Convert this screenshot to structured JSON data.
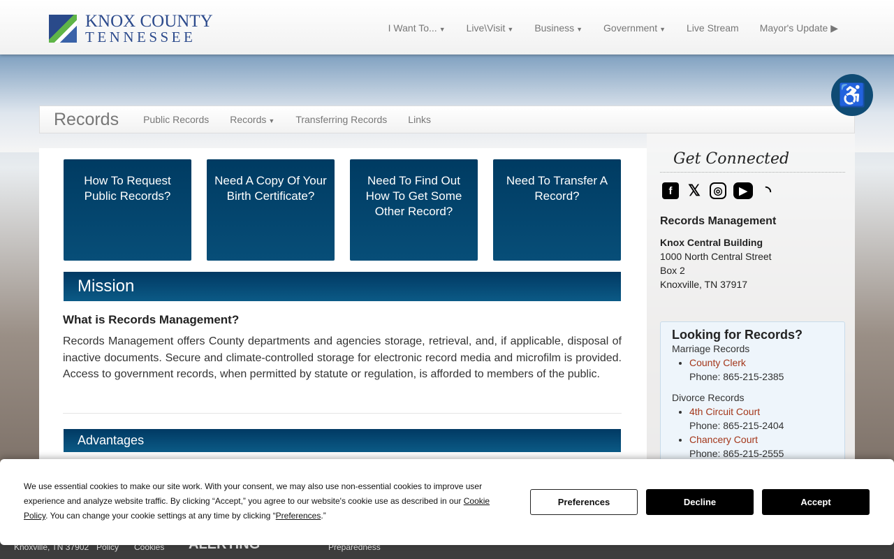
{
  "header": {
    "logo_line1": "KNOX COUNTY",
    "logo_line2": "TENNESSEE",
    "nav": [
      "I Want To...",
      "Live\\Visit",
      "Business",
      "Government",
      "Live Stream",
      "Mayor's Update"
    ]
  },
  "subnav": {
    "brand": "Records",
    "items": [
      "Public Records",
      "Records",
      "Transferring Records",
      "Links"
    ]
  },
  "tiles": [
    "How To Request Public Records?",
    "Need A Copy Of Your Birth Certificate?",
    "Need To Find Out How To Get Some Other Record?",
    "Need To Transfer A Record?"
  ],
  "main": {
    "mission": "Mission",
    "question": "What is Records Management?",
    "paragraph": "Records Management offers County departments and agencies storage, retrieval, and, if applicable, disposal of inactive documents. Secure and climate-controlled storage for electronic record media and microfilm is provided. Access to government records, when permitted by statute or regulation, is afforded to members of the public.",
    "advantages": "Advantages"
  },
  "sidebar": {
    "get_connected": "Get Connected",
    "social": [
      "facebook",
      "x",
      "instagram",
      "youtube",
      "rss"
    ],
    "office": "Records Management",
    "building": "Knox Central Building",
    "street": "1000 North Central Street",
    "box": "Box 2",
    "city": "Knoxville, TN 37917",
    "looking": {
      "title": "Looking for Records?",
      "marriage": "Marriage Records",
      "clerk": "County Clerk",
      "clerk_phone": "Phone: 865-215-2385",
      "divorce": "Divorce Records",
      "circuit": "4th Circuit Court",
      "circuit_phone": "Phone: 865-215-2404",
      "chancery": "Chancery Court",
      "chancery_phone": "Phone: 865-215-2555"
    }
  },
  "footer": {
    "address": "Knoxville, TN 37902",
    "policy": "Policy",
    "cookies": "Cookies",
    "alerting": "ALERTING",
    "preparedness": "Preparedness"
  },
  "cookie": {
    "text1": "We use essential cookies to make our site work. With your consent, we may also use non-essential cookies to improve user experience and analyze website traffic. By clicking “Accept,” you agree to our website's cookie use as described in our ",
    "link1": "Cookie Policy",
    "text2": ". You can change your cookie settings at any time by clicking “",
    "link2": "Preferences",
    "text3": ".”",
    "preferences": "Preferences",
    "decline": "Decline",
    "accept": "Accept"
  }
}
